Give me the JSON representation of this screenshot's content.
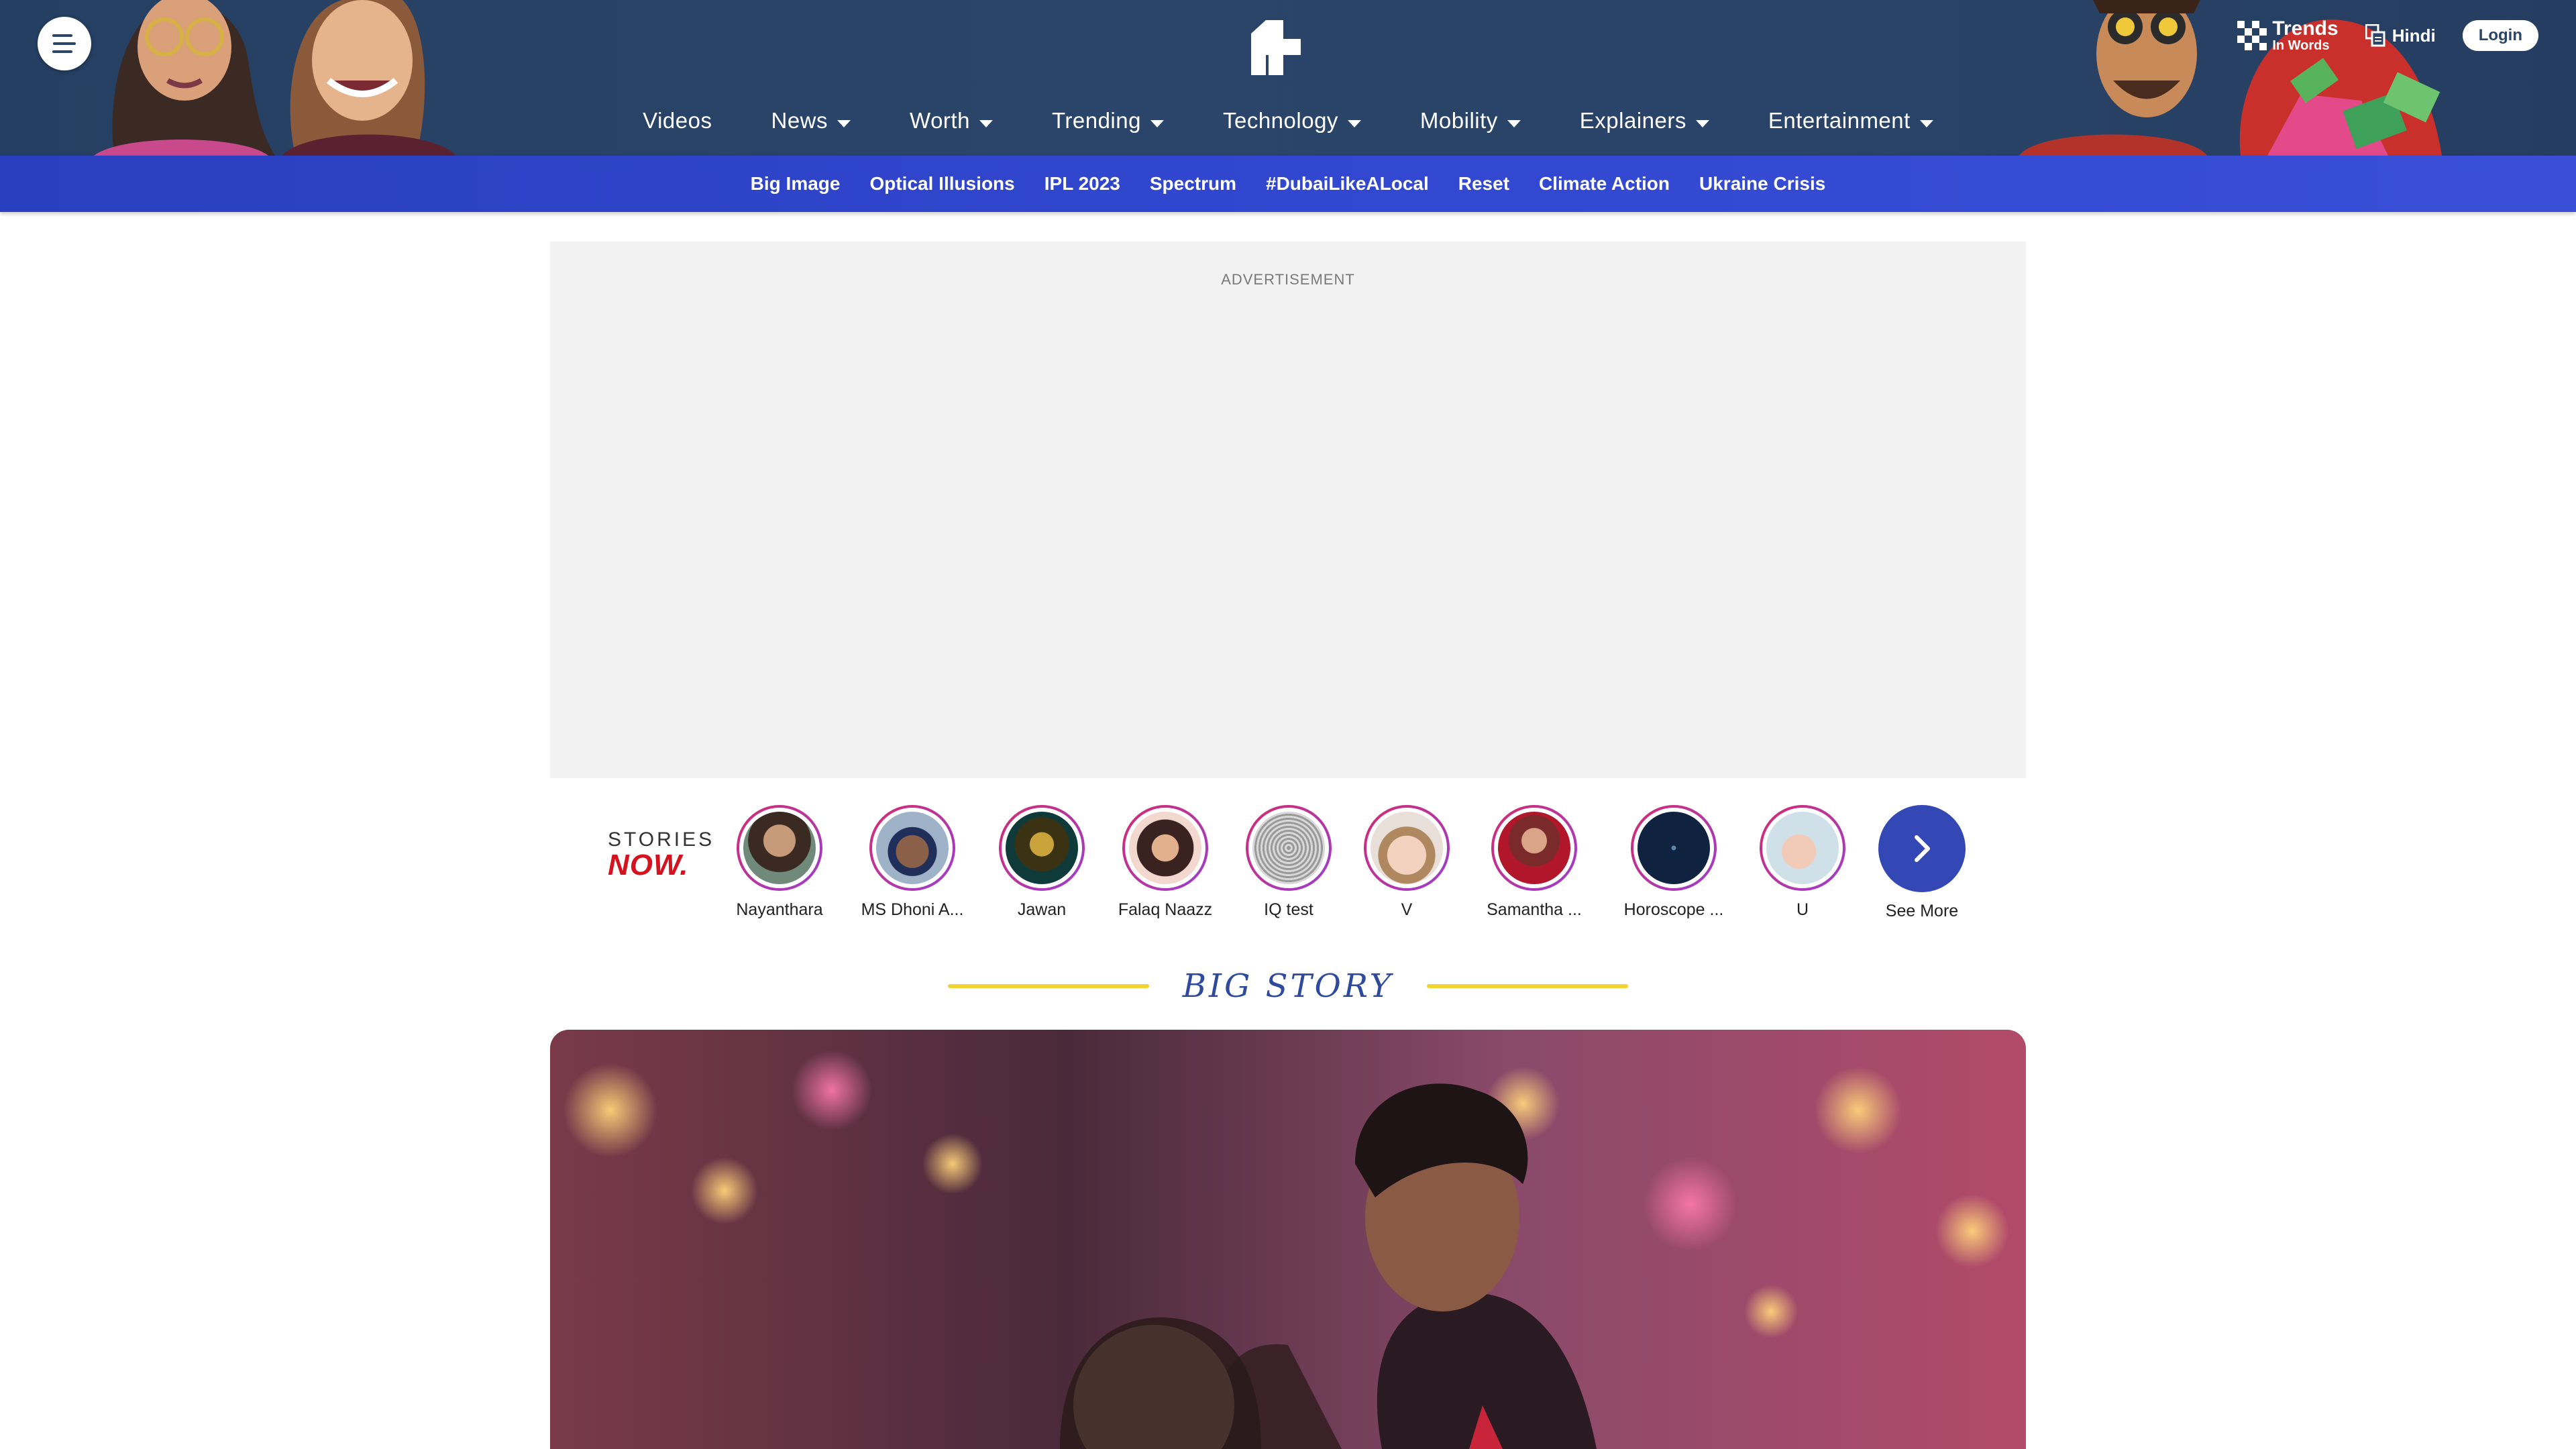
{
  "header": {
    "nav": [
      {
        "label": "Videos",
        "dropdown": false
      },
      {
        "label": "News",
        "dropdown": true
      },
      {
        "label": "Worth",
        "dropdown": true
      },
      {
        "label": "Trending",
        "dropdown": true
      },
      {
        "label": "Technology",
        "dropdown": true
      },
      {
        "label": "Mobility",
        "dropdown": true
      },
      {
        "label": "Explainers",
        "dropdown": true
      },
      {
        "label": "Entertainment",
        "dropdown": true
      }
    ],
    "trends": {
      "line1": "Trends",
      "line2": "In Words"
    },
    "language": "Hindi",
    "login": "Login"
  },
  "subnav": [
    "Big Image",
    "Optical Illusions",
    "IPL 2023",
    "Spectrum",
    "#DubaiLikeALocal",
    "Reset",
    "Climate Action",
    "Ukraine Crisis"
  ],
  "ad": {
    "label": "ADVERTISEMENT"
  },
  "stories": {
    "brand_top": "STORIES",
    "brand_bottom": "NOW.",
    "items": [
      {
        "label": "Nayanthara"
      },
      {
        "label": "MS Dhoni A..."
      },
      {
        "label": "Jawan"
      },
      {
        "label": "Falaq Naazz"
      },
      {
        "label": "IQ test"
      },
      {
        "label": "V"
      },
      {
        "label": "Samantha ..."
      },
      {
        "label": "Horoscope ..."
      },
      {
        "label": "U"
      }
    ],
    "see_more": "See More"
  },
  "big_story": {
    "heading": "BIG STORY"
  },
  "colors": {
    "header": "#2a4569",
    "subnav": "#3147cf",
    "accent_red": "#d6121f",
    "accent_yellow": "#f1d431",
    "heading_blue": "#2e4a9c"
  }
}
